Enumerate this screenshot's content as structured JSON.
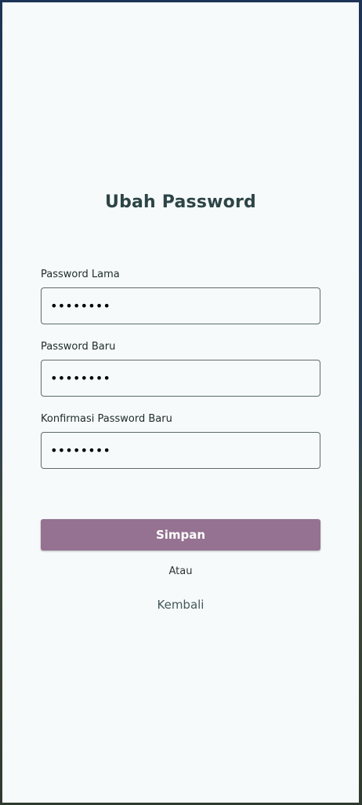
{
  "page": {
    "title": "Ubah Password"
  },
  "form": {
    "fields": [
      {
        "label": "Password Lama",
        "value": "••••••••"
      },
      {
        "label": "Password Baru",
        "value": "••••••••"
      },
      {
        "label": "Konfirmasi Password Baru",
        "value": "••••••••"
      }
    ],
    "save_label": "Simpan",
    "or_label": "Atau",
    "back_label": "Kembali"
  },
  "colors": {
    "primary_button": "#957291",
    "title": "#2d4447",
    "background": "#f6fafa"
  }
}
